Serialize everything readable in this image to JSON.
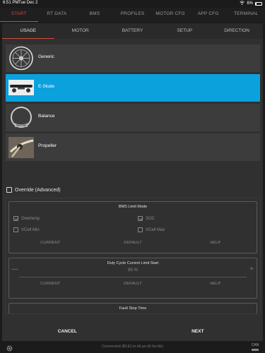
{
  "status_bar": {
    "time": "6:51 PM",
    "date": "Tue Dec 2",
    "battery": "6%"
  },
  "top_tabs": [
    "START",
    "RT DATA",
    "BMS",
    "PROFILES",
    "MOTOR CFG",
    "APP CFG",
    "TERMINAL"
  ],
  "sub_tabs": [
    "USAGE",
    "MOTOR",
    "BATTERY",
    "SETUP",
    "DIRECTION"
  ],
  "usage_items": [
    {
      "label": "Generic",
      "icon": "generic-wheel-icon"
    },
    {
      "label": "E-Skate",
      "icon": "eskate-board-icon"
    },
    {
      "label": "Balance",
      "icon": "balance-wheel-icon"
    },
    {
      "label": "Propeller",
      "icon": "propeller-icon"
    }
  ],
  "override": {
    "label": "Override (Advanced)"
  },
  "bms_group": {
    "title": "BMS Limit Mode",
    "checks": [
      {
        "label": "Overtemp",
        "checked": true
      },
      {
        "label": "SOC",
        "checked": true
      },
      {
        "label": "VCell Min",
        "checked": false
      },
      {
        "label": "VCell Max",
        "checked": false
      }
    ],
    "buttons": [
      "CURRENT",
      "DEFAULT",
      "HELP"
    ]
  },
  "duty_group": {
    "title": "Duty Cycle Current Limit Start",
    "value": "85 %",
    "minus": "—",
    "plus": "+",
    "buttons": [
      "CURRENT",
      "DEFAULT",
      "HELP"
    ]
  },
  "fault_group": {
    "title": "Fault Stop Time"
  },
  "footer": {
    "cancel": "CANCEL",
    "next": "NEXT"
  },
  "bottom_bar": {
    "status": "Connected (BLE) to tiil.an-(6-6e-bk)",
    "can": "CAN"
  },
  "colors": {
    "accent": "#d04a3b",
    "selected": "#0aa1dd"
  }
}
